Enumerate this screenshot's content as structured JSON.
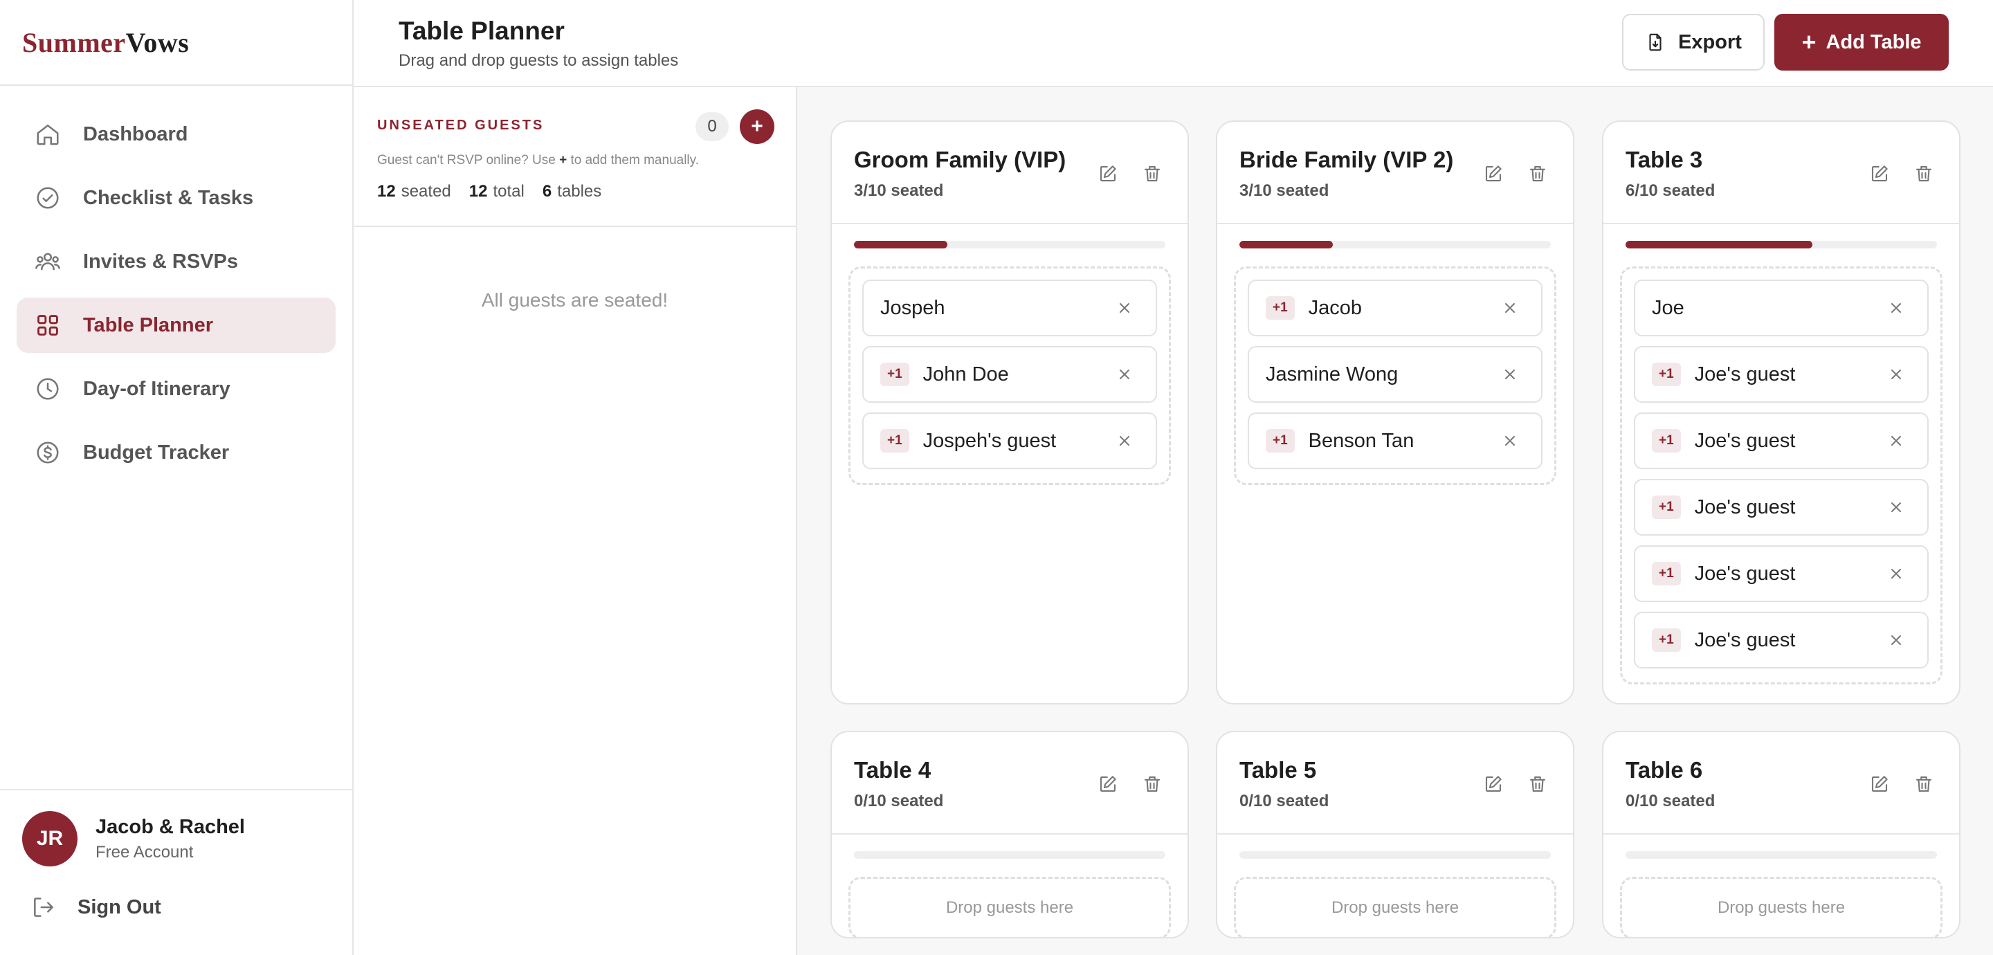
{
  "brand": {
    "part1": "Summer",
    "part2": "Vows"
  },
  "nav": {
    "items": [
      {
        "label": "Dashboard",
        "icon": "home-icon",
        "active": false
      },
      {
        "label": "Checklist & Tasks",
        "icon": "check-circle-icon",
        "active": false
      },
      {
        "label": "Invites & RSVPs",
        "icon": "users-icon",
        "active": false
      },
      {
        "label": "Table Planner",
        "icon": "grid-icon",
        "active": true
      },
      {
        "label": "Day-of Itinerary",
        "icon": "clock-icon",
        "active": false
      },
      {
        "label": "Budget Tracker",
        "icon": "dollar-icon",
        "active": false
      }
    ]
  },
  "user": {
    "initials": "JR",
    "name": "Jacob & Rachel",
    "plan": "Free Account"
  },
  "signout": {
    "label": "Sign Out"
  },
  "header": {
    "title": "Table Planner",
    "subtitle": "Drag and drop guests to assign tables",
    "export_label": "Export",
    "add_label": "Add Table",
    "add_plus": "+"
  },
  "unseated": {
    "title": "UNSEATED GUESTS",
    "count": "0",
    "add_symbol": "+",
    "hint_before": "Guest can't RSVP online? Use",
    "hint_symbol": "+",
    "hint_after": "to add them manually.",
    "stats": {
      "seated": "12",
      "seated_label": "seated",
      "total": "12",
      "total_label": "total",
      "tables": "6",
      "tables_label": "tables"
    },
    "empty_message": "All guests are seated!"
  },
  "drop_placeholder": "Drop guests here",
  "plus_one_badge": "+1",
  "colors": {
    "accent": "#8b2530",
    "accent_soft": "#f3e8e9"
  },
  "tables": [
    {
      "name": "Groom Family (VIP)",
      "seated_text": "3/10 seated",
      "fill_fraction": 0.3,
      "guests": [
        {
          "name": "Jospeh",
          "plus_one": false
        },
        {
          "name": "John Doe",
          "plus_one": true
        },
        {
          "name": "Jospeh's guest",
          "plus_one": true
        }
      ]
    },
    {
      "name": "Bride Family (VIP 2)",
      "seated_text": "3/10 seated",
      "fill_fraction": 0.3,
      "guests": [
        {
          "name": "Jacob",
          "plus_one": true
        },
        {
          "name": "Jasmine Wong",
          "plus_one": false
        },
        {
          "name": "Benson Tan",
          "plus_one": true
        }
      ]
    },
    {
      "name": "Table 3",
      "seated_text": "6/10 seated",
      "fill_fraction": 0.6,
      "guests": [
        {
          "name": "Joe",
          "plus_one": false
        },
        {
          "name": "Joe's guest",
          "plus_one": true
        },
        {
          "name": "Joe's guest",
          "plus_one": true
        },
        {
          "name": "Joe's guest",
          "plus_one": true
        },
        {
          "name": "Joe's guest",
          "plus_one": true
        },
        {
          "name": "Joe's guest",
          "plus_one": true
        }
      ]
    },
    {
      "name": "Table 4",
      "seated_text": "0/10 seated",
      "fill_fraction": 0,
      "guests": []
    },
    {
      "name": "Table 5",
      "seated_text": "0/10 seated",
      "fill_fraction": 0,
      "guests": []
    },
    {
      "name": "Table 6",
      "seated_text": "0/10 seated",
      "fill_fraction": 0,
      "guests": []
    }
  ]
}
